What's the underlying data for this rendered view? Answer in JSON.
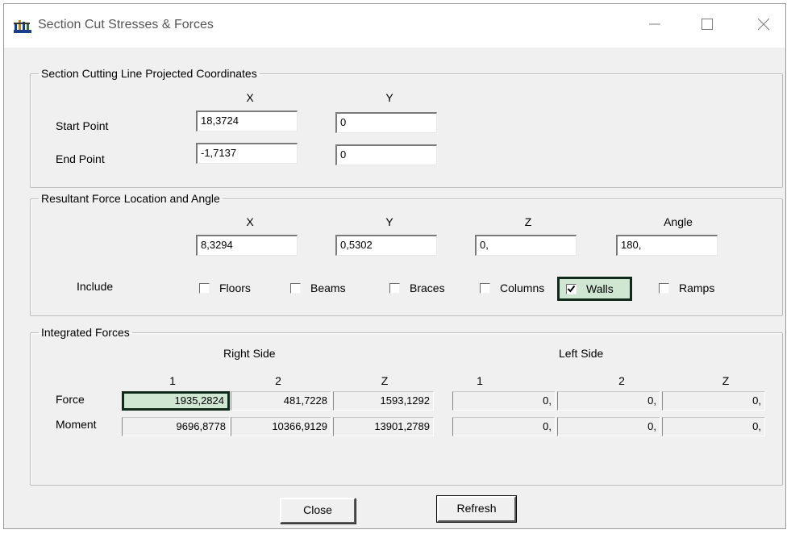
{
  "window": {
    "title": "Section Cut Stresses & Forces",
    "icons": {
      "app": "structure-app-icon",
      "minimize": "minimize-icon",
      "maximize": "maximize-icon",
      "close": "close-icon"
    }
  },
  "cutting_line": {
    "legend": "Section Cutting Line Projected Coordinates",
    "col_x": "X",
    "col_y": "Y",
    "start_label": "Start Point",
    "start_x": "18,3724",
    "start_y": "0",
    "end_label": "End Point",
    "end_x": "-1,7137",
    "end_y": "0"
  },
  "resultant": {
    "legend": "Resultant Force Location and Angle",
    "col_x": "X",
    "col_y": "Y",
    "col_z": "Z",
    "col_angle": "Angle",
    "x": "8,3294",
    "y": "0,5302",
    "z": "0,",
    "angle": "180,",
    "include_label": "Include",
    "include": [
      {
        "label": "Floors",
        "checked": false
      },
      {
        "label": "Beams",
        "checked": false
      },
      {
        "label": "Braces",
        "checked": false
      },
      {
        "label": "Columns",
        "checked": false
      },
      {
        "label": "Walls",
        "checked": true
      },
      {
        "label": "Ramps",
        "checked": false
      }
    ]
  },
  "integrated": {
    "legend": "Integrated Forces",
    "right_side": "Right Side",
    "left_side": "Left Side",
    "col_headers": [
      "1",
      "2",
      "Z",
      "1",
      "2",
      "Z"
    ],
    "force_label": "Force",
    "moment_label": "Moment",
    "force": [
      "1935,2824",
      "481,7228",
      "1593,1292",
      "0,",
      "0,",
      "0,"
    ],
    "moment": [
      "9696,8778",
      "10366,9129",
      "13901,2789",
      "0,",
      "0,",
      "0,"
    ]
  },
  "buttons": {
    "close": "Close",
    "refresh": "Refresh"
  },
  "colors": {
    "highlight_fill": "#cfe6d3",
    "highlight_border": "#0f2a1a"
  }
}
